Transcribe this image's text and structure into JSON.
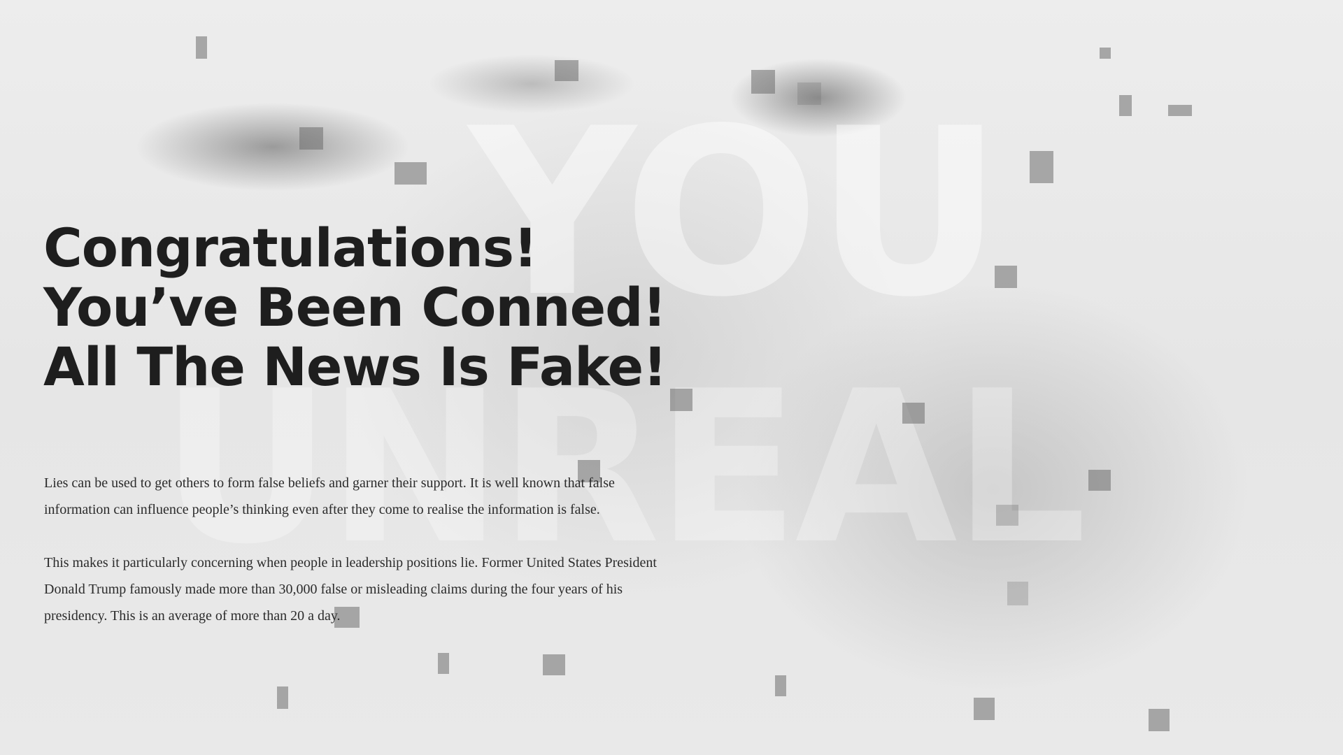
{
  "headline": {
    "line1": "Congratulations!",
    "line2": "You’ve Been Conned!",
    "line3": "All The News Is Fake!"
  },
  "background_text": {
    "top": "YOU",
    "bottom": "UNREAL"
  },
  "paragraphs": [
    "Lies can be used to get others to form false beliefs and garner their support. It is well known that false information can influence people’s thinking even after they come to realise the information is false.",
    "This makes it particularly concerning when people in leadership positions lie. Former United States President Donald Trump famously made more than 30,000 false or misleading claims during the four years of his presidency. This is an average of more than 20 a day."
  ],
  "colors": {
    "background": "#ececec",
    "headline": "#1e1e1e",
    "body": "#2b2b2b"
  }
}
